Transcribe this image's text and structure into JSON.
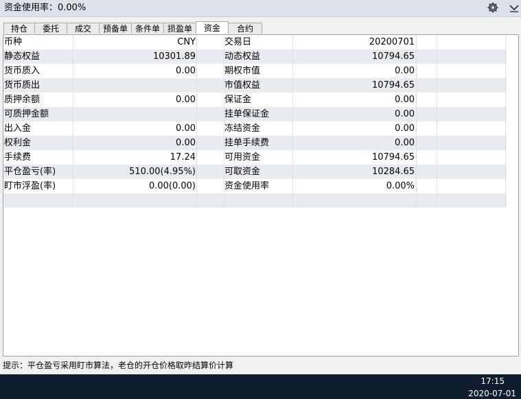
{
  "header": {
    "title": "资金使用率：0.00%",
    "settings_icon": "gear-icon",
    "menu_icon": "chevron-down-icon"
  },
  "tabs": [
    {
      "label": "持仓"
    },
    {
      "label": "委托"
    },
    {
      "label": "成交"
    },
    {
      "label": "预备单"
    },
    {
      "label": "条件单"
    },
    {
      "label": "损盈单"
    },
    {
      "label": "资金",
      "active": true
    },
    {
      "label": "合约"
    }
  ],
  "rows": [
    {
      "l1": "币种",
      "v1": "CNY",
      "l2": "交易日",
      "v2": "20200701"
    },
    {
      "l1": "静态权益",
      "v1": "10301.89",
      "l2": "动态权益",
      "v2": "10794.65"
    },
    {
      "l1": "货币质入",
      "v1": "0.00",
      "l2": "期权市值",
      "v2": "0.00"
    },
    {
      "l1": "货币质出",
      "v1": "",
      "l2": "市值权益",
      "v2": "10794.65"
    },
    {
      "l1": "质押余额",
      "v1": "0.00",
      "l2": "保证金",
      "v2": "0.00"
    },
    {
      "l1": "可质押金额",
      "v1": "",
      "l2": "挂单保证金",
      "v2": "0.00"
    },
    {
      "l1": "出入金",
      "v1": "0.00",
      "l2": "冻结资金",
      "v2": "0.00"
    },
    {
      "l1": "权利金",
      "v1": "0.00",
      "l2": "挂单手续费",
      "v2": "0.00"
    },
    {
      "l1": "手续费",
      "v1": "17.24",
      "l2": "可用资金",
      "v2": "10794.65"
    },
    {
      "l1": "平仓盈亏(率)",
      "v1": "510.00(4.95%)",
      "l2": "可取资金",
      "v2": "10284.65"
    },
    {
      "l1": "盯市浮盈(率)",
      "v1": "0.00(0.00)",
      "l2": "资金使用率",
      "v2": "0.00%"
    },
    {
      "l1": "",
      "v1": "",
      "l2": "",
      "v2": ""
    }
  ],
  "status": {
    "hint": "提示：平仓盈亏采用盯市算法，老仓的开仓价格取昨结算价计算"
  },
  "taskbar": {
    "time": "17:15",
    "date": "2020-07-01"
  }
}
